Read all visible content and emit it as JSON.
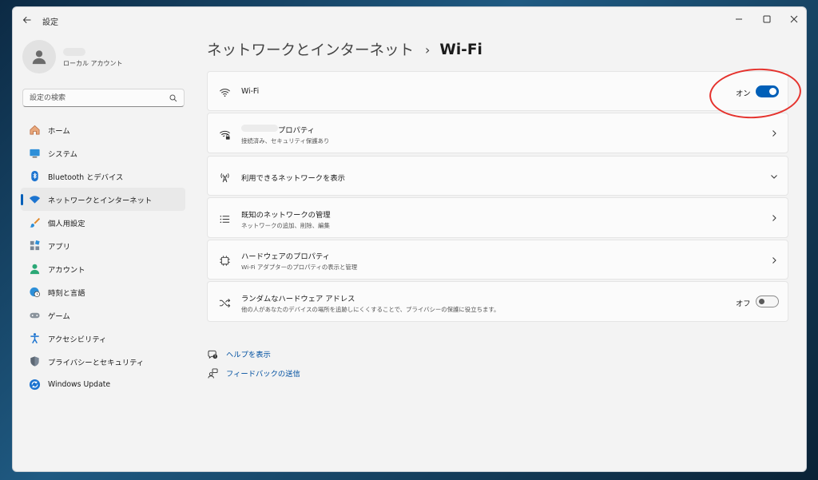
{
  "app": {
    "title": "設定"
  },
  "account": {
    "type": "ローカル アカウント"
  },
  "search": {
    "placeholder": "設定の検索"
  },
  "sidebar": {
    "items": [
      {
        "label": "ホーム",
        "icon": "home-icon"
      },
      {
        "label": "システム",
        "icon": "monitor-icon"
      },
      {
        "label": "Bluetooth とデバイス",
        "icon": "bluetooth-icon"
      },
      {
        "label": "ネットワークとインターネット",
        "icon": "wifi-icon",
        "active": true
      },
      {
        "label": "個人用設定",
        "icon": "brush-icon"
      },
      {
        "label": "アプリ",
        "icon": "apps-icon"
      },
      {
        "label": "アカウント",
        "icon": "person-icon"
      },
      {
        "label": "時刻と言語",
        "icon": "globe-clock-icon"
      },
      {
        "label": "ゲーム",
        "icon": "gamepad-icon"
      },
      {
        "label": "アクセシビリティ",
        "icon": "accessibility-icon"
      },
      {
        "label": "プライバシーとセキュリティ",
        "icon": "shield-icon"
      },
      {
        "label": "Windows Update",
        "icon": "update-icon"
      }
    ]
  },
  "breadcrumb": {
    "parent": "ネットワークとインターネット",
    "separator": "›",
    "current": "Wi-Fi"
  },
  "cards": {
    "wifi": {
      "title": "Wi-Fi",
      "state_label": "オン",
      "state": "on"
    },
    "properties": {
      "title": "プロパティ",
      "subtitle": "接続済み、セキュリティ保護あり"
    },
    "available": {
      "title": "利用できるネットワークを表示"
    },
    "known": {
      "title": "既知のネットワークの管理",
      "subtitle": "ネットワークの追加、削除、編集"
    },
    "hardware": {
      "title": "ハードウェアのプロパティ",
      "subtitle": "Wi-Fi アダプターのプロパティの表示と管理"
    },
    "random": {
      "title": "ランダムなハードウェア アドレス",
      "subtitle": "他の人があなたのデバイスの場所を追跡しにくくすることで、プライバシーの保護に役立ちます。",
      "state_label": "オフ",
      "state": "off"
    }
  },
  "links": {
    "help": "ヘルプを表示",
    "feedback": "フィードバックの送信"
  },
  "colors": {
    "accent": "#005fb8",
    "annotation": "#e5322d"
  }
}
